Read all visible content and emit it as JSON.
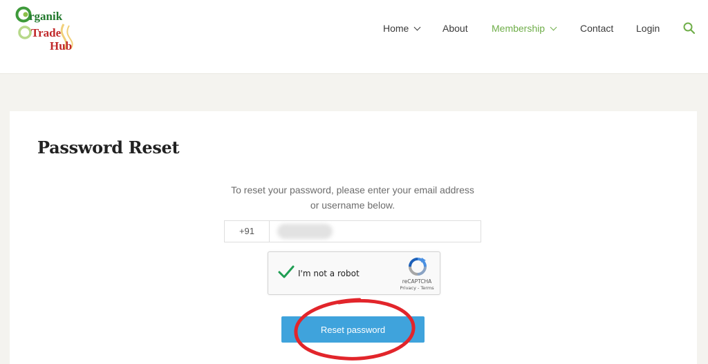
{
  "header": {
    "logo": {
      "word1": "rganik",
      "word2": "Trade",
      "word3": "Hub"
    },
    "nav": [
      {
        "label": "Home",
        "has_dropdown": true,
        "active": false
      },
      {
        "label": "About",
        "has_dropdown": false,
        "active": false
      },
      {
        "label": "Membership",
        "has_dropdown": true,
        "active": true
      },
      {
        "label": "Contact",
        "has_dropdown": false,
        "active": false
      },
      {
        "label": "Login",
        "has_dropdown": false,
        "active": false
      }
    ],
    "search_icon": "search-icon"
  },
  "main": {
    "title": "Password Reset",
    "instructions_line1": "To reset your password, please enter your email address",
    "instructions_line2": "or username below.",
    "phone": {
      "prefix": "+91",
      "value": ""
    },
    "captcha": {
      "label": "I'm not a robot",
      "brand": "reCAPTCHA",
      "links": "Privacy - Terms"
    },
    "reset_button": "Reset password"
  },
  "colors": {
    "accent_green": "#6fae49",
    "button_blue": "#3fa3dc",
    "annotation_red": "#e2252b",
    "logo_green": "#237a2e",
    "logo_red": "#c0282a"
  }
}
